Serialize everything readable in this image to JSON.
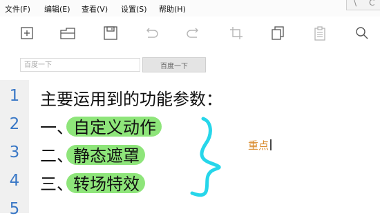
{
  "menu": [
    {
      "key": "file",
      "label": "文件(F)"
    },
    {
      "key": "edit",
      "label": "编辑(E)"
    },
    {
      "key": "view",
      "label": "查看(V)"
    },
    {
      "key": "settings",
      "label": "设置(S)"
    },
    {
      "key": "help",
      "label": "帮助(H)"
    }
  ],
  "toolbar": {
    "icons": [
      "new-file-icon",
      "folder-icon",
      "save-icon",
      "undo-icon",
      "redo-icon",
      "crop-icon",
      "copy-icon",
      "clipboard-icon",
      "search-icon"
    ]
  },
  "search": {
    "placeholder": "百度一下",
    "button_label": "百度一下"
  },
  "editor": {
    "line_numbers": [
      "1",
      "2",
      "3",
      "4",
      "5"
    ],
    "line1": "主要运用到的功能参数：",
    "line2_prefix": "一、",
    "line2_highlight": "自定义动作",
    "line3_prefix": "二、",
    "line3_highlight": "静态遮罩",
    "line4_prefix": "三、",
    "line4_highlight": "转场特效",
    "annotation": "重点",
    "highlight_color": "#8ee57a",
    "brace_color": "#26d6ea",
    "annotation_color": "#d98a2b",
    "line_number_color": "#3a78c6"
  }
}
